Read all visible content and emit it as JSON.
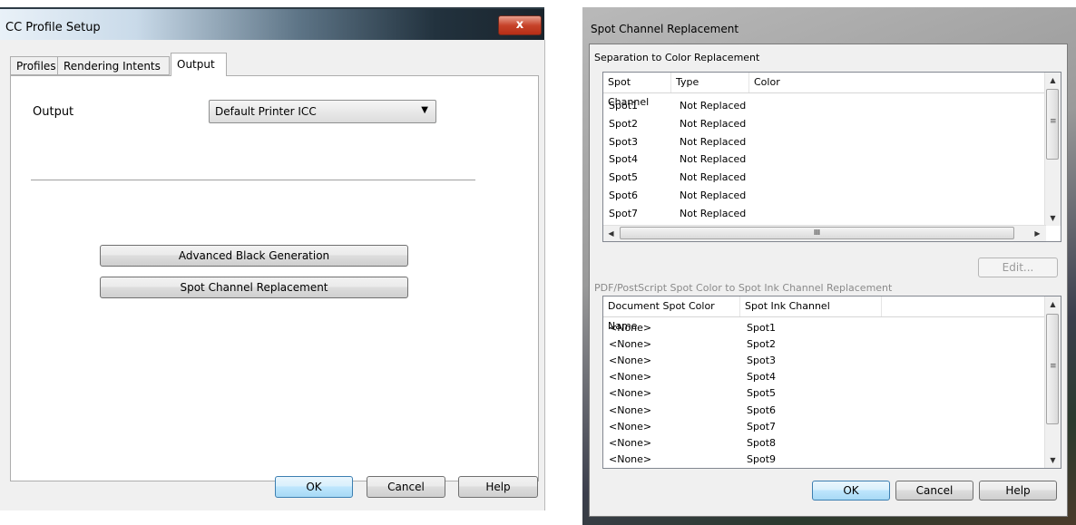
{
  "icc_dialog": {
    "title": "CC Profile Setup",
    "close_glyph": "x",
    "tabs": [
      {
        "label": "Profiles",
        "active": false
      },
      {
        "label": "Rendering Intents",
        "active": false
      },
      {
        "label": "Output",
        "active": true
      }
    ],
    "output_label": "Output",
    "output_select": {
      "value": "Default Printer ICC",
      "arrow": "▼"
    },
    "advanced_black_label": "Advanced Black Generation",
    "spot_channel_label": "Spot Channel Replacement",
    "ok_label": "OK",
    "cancel_label": "Cancel",
    "help_label": "Help"
  },
  "spot_dialog": {
    "title": "Spot Channel Replacement",
    "sep_group_label": "Separation to Color Replacement",
    "sep_columns": [
      "Spot Channel",
      "Type",
      "Color"
    ],
    "sep_rows": [
      {
        "channel": "Spot1",
        "type": "Not Replaced",
        "color": ""
      },
      {
        "channel": "Spot2",
        "type": "Not Replaced",
        "color": ""
      },
      {
        "channel": "Spot3",
        "type": "Not Replaced",
        "color": ""
      },
      {
        "channel": "Spot4",
        "type": "Not Replaced",
        "color": ""
      },
      {
        "channel": "Spot5",
        "type": "Not Replaced",
        "color": ""
      },
      {
        "channel": "Spot6",
        "type": "Not Replaced",
        "color": ""
      },
      {
        "channel": "Spot7",
        "type": "Not Replaced",
        "color": ""
      }
    ],
    "edit_label": "Edit...",
    "pdf_group_label": "PDF/PostScript Spot Color to Spot Ink Channel Replacement",
    "pdf_columns": [
      "Document Spot Color Name",
      "Spot Ink Channel"
    ],
    "pdf_rows": [
      {
        "name": "<None>",
        "channel": "Spot1"
      },
      {
        "name": "<None>",
        "channel": "Spot2"
      },
      {
        "name": "<None>",
        "channel": "Spot3"
      },
      {
        "name": "<None>",
        "channel": "Spot4"
      },
      {
        "name": "<None>",
        "channel": "Spot5"
      },
      {
        "name": "<None>",
        "channel": "Spot6"
      },
      {
        "name": "<None>",
        "channel": "Spot7"
      },
      {
        "name": "<None>",
        "channel": "Spot8"
      },
      {
        "name": "<None>",
        "channel": "Spot9"
      }
    ],
    "ok_label": "OK",
    "cancel_label": "Cancel",
    "help_label": "Help"
  },
  "icons": {
    "scroll_up": "▲",
    "scroll_down": "▼",
    "scroll_left": "◀",
    "scroll_right": "▶",
    "grip_v": "≡",
    "grip_h": "III"
  },
  "colors": {
    "close_button": "#c7432a",
    "default_button_border": "#3c7fb1",
    "window_background": "#f0f0f0"
  }
}
